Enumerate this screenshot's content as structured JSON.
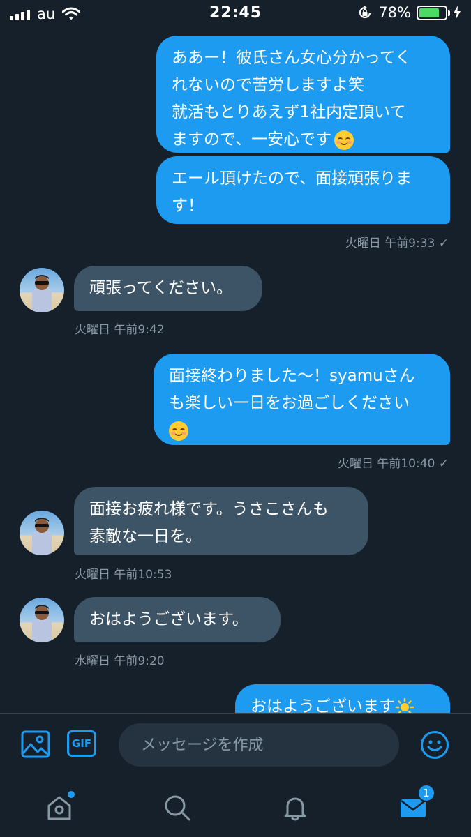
{
  "status_bar": {
    "carrier": "au",
    "time": "22:45",
    "battery": "78%",
    "battery_level": 0.78
  },
  "messages": [
    {
      "type": "sent",
      "text": "ああー！彼氏さん女心分かってく\nれないので苦労しますよ笑\n就活もとりあえず1社内定頂いて\nますので、一安心です"
    },
    {
      "type": "sent",
      "text": "エール頂けたので、面接頑張りま\nす！"
    },
    {
      "type": "timestamp",
      "text": "火曜日 午前9:33 ✓"
    },
    {
      "type": "received",
      "text": "頑張ってください。"
    },
    {
      "type": "timestamp",
      "text": "火曜日 午前9:42"
    },
    {
      "type": "sent",
      "text": "面接終わりました〜！syamuさん\nも楽しい一日をお過ごしください"
    },
    {
      "type": "timestamp",
      "text": "火曜日 午前10:40 ✓"
    },
    {
      "type": "received",
      "text": "面接お疲れ様です。うさこさんも\n素敵な一日を。"
    },
    {
      "type": "timestamp",
      "text": "火曜日 午前10:53"
    },
    {
      "type": "received",
      "text": "おはようございます。"
    },
    {
      "type": "timestamp",
      "text": "水曜日 午前9:20"
    },
    {
      "type": "sent",
      "text": "おはようございます"
    }
  ],
  "composer": {
    "placeholder": "メッセージを作成",
    "gif_label": "GIF",
    "icons": [
      "image-icon",
      "gif-icon",
      "emoji-icon"
    ]
  },
  "tabbar": {
    "items": [
      "home-icon",
      "search-icon",
      "bell-icon",
      "mail-icon"
    ],
    "mail_badge": "1"
  },
  "colors": {
    "background": "#15202b",
    "sent_bubble": "#1d9bf0",
    "received_bubble": "#3d5466",
    "secondary_text": "#8899a6",
    "accent": "#1d9bf0"
  }
}
